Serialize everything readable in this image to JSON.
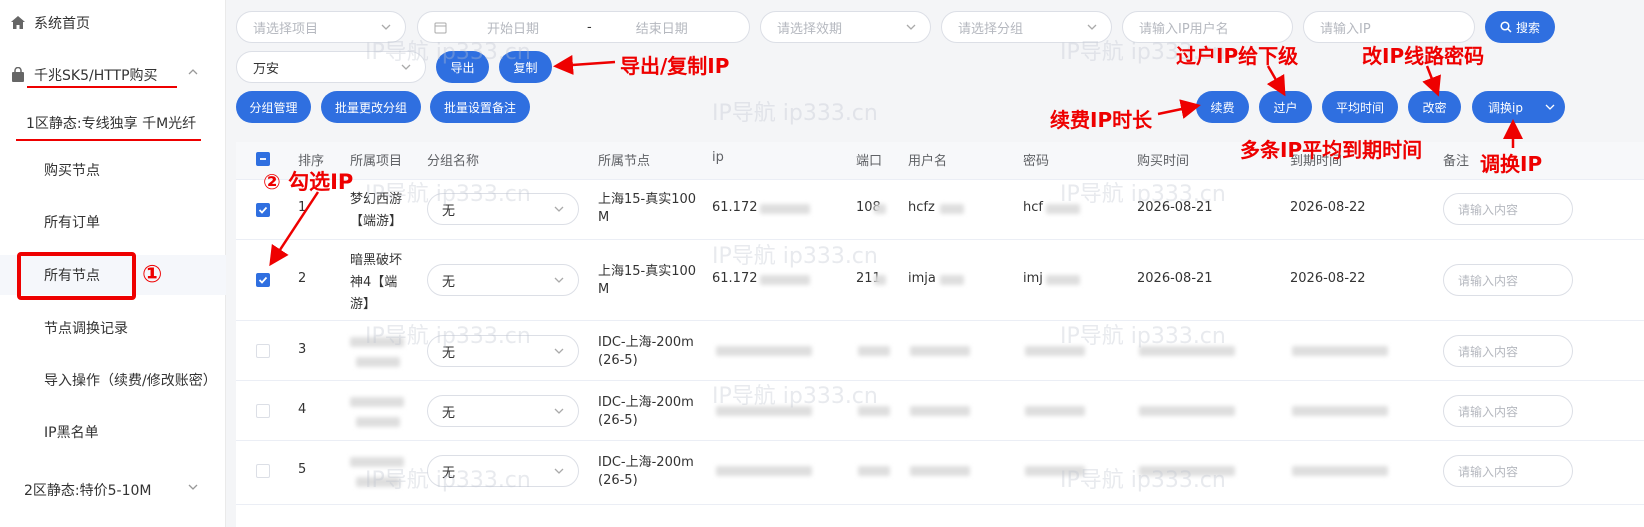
{
  "sidebar": {
    "home": "系统首页",
    "buy_menu": "千兆SK5/HTTP购买",
    "zone1": "1区静态:专线独享 千M光纤",
    "items": [
      "购买节点",
      "所有订单",
      "所有节点",
      "节点调换记录",
      "导入操作（续费/修改账密）",
      "IP黑名单"
    ],
    "zone2": "2区静态:特价5-10M"
  },
  "filters": {
    "project_ph": "请选择项目",
    "start_ph": "开始日期",
    "date_sep": "-",
    "end_ph": "结束日期",
    "validity_ph": "请选择效期",
    "group_ph": "请选择分组",
    "ipuser_ph": "请输入IP用户名",
    "ip_ph": "请输入IP",
    "search": "搜索",
    "region_value": "万安"
  },
  "buttons": {
    "export": "导出",
    "copy": "复制",
    "group_manage": "分组管理",
    "batch_group": "批量更改分组",
    "batch_note": "批量设置备注",
    "renew": "续费",
    "transfer": "过户",
    "avg_time": "平均时间",
    "change_pwd": "改密",
    "swap_ip": "调换ip"
  },
  "annotations": {
    "export_copy": "导出/复制IP",
    "transfer": "过户IP给下级",
    "change_pwd": "改IP线路密码",
    "renew": "续费IP时长",
    "avg": "多条IP平均到期时间",
    "swap": "调换IP",
    "step1": "①",
    "step2": "② 勾选IP"
  },
  "table": {
    "headers": [
      "排序",
      "所属项目",
      "分组名称",
      "所属节点",
      "ip",
      "端口",
      "用户名",
      "密码",
      "购买时间",
      "到期时间",
      "备注"
    ],
    "note_ph": "请输入内容",
    "rows": [
      {
        "no": "1",
        "project": [
          "梦幻西游",
          "【端游】"
        ],
        "group": "无",
        "node": [
          "上海15-真实100",
          "M"
        ],
        "ip": "61.172",
        "port": "108",
        "user": "hcfz",
        "pwd": "hcf",
        "buy": "2026-08-21",
        "expire": "2026-08-22",
        "checked": true
      },
      {
        "no": "2",
        "project": [
          "暗黑破坏",
          "神4【端",
          "游】"
        ],
        "group": "无",
        "node": [
          "上海15-真实100",
          "M"
        ],
        "ip": "61.172",
        "port": "211",
        "user": "imja",
        "pwd": "imj",
        "buy": "2026-08-21",
        "expire": "2026-08-22",
        "checked": true
      },
      {
        "no": "3",
        "project": [],
        "group": "无",
        "node": [
          "IDC-上海-200m",
          "(26-5)"
        ],
        "ip": "",
        "port": "",
        "user": "",
        "pwd": "",
        "buy": "",
        "expire": "",
        "checked": false
      },
      {
        "no": "4",
        "project": [],
        "group": "无",
        "node": [
          "IDC-上海-200m",
          "(26-5)"
        ],
        "ip": "",
        "port": "",
        "user": "",
        "pwd": "",
        "buy": "",
        "expire": "",
        "checked": false
      },
      {
        "no": "5",
        "project": [],
        "group": "无",
        "node": [
          "IDC-上海-200m",
          "(26-5)"
        ],
        "ip": "",
        "port": "",
        "user": "",
        "pwd": "",
        "buy": "",
        "expire": "",
        "checked": false
      }
    ]
  },
  "watermark": "IP导航  ip333.cn",
  "colors": {
    "primary": "#2f6fe0",
    "annotation": "#e00000"
  }
}
